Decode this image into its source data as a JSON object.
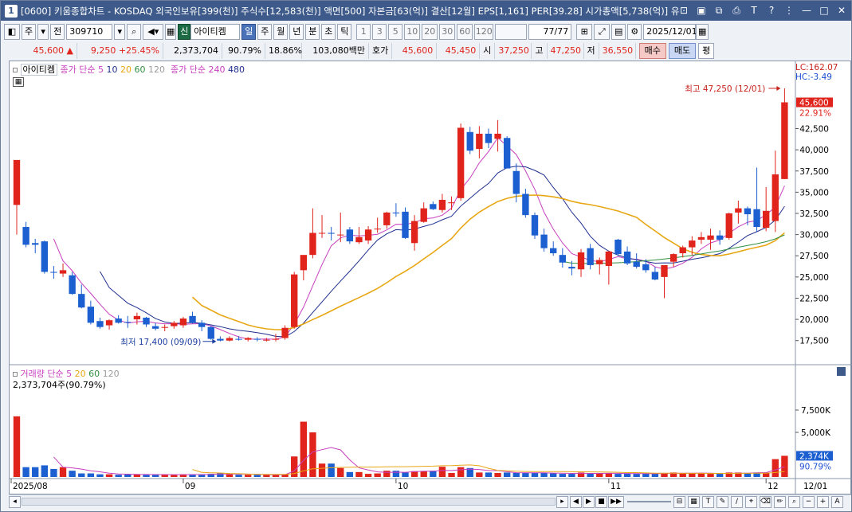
{
  "title": {
    "badge": "1",
    "text": "[0600] 키움종합차트 - KOSDAQ 외국인보유[399(천)] 주식수[12,583(천)] 액면[500] 자본금[63(억)] 결산[12월] EPS[1,161] PER[39.28] 시가총액[5,738(억)] 유"
  },
  "toolbar": {
    "mode_label": "주",
    "prev_label": "전",
    "code": "309710",
    "stock_badge": "신",
    "stock_name": "아이티켐",
    "period_buttons": [
      "일",
      "주",
      "월",
      "년",
      "분",
      "초",
      "틱"
    ],
    "interval_buttons": [
      "1",
      "3",
      "5",
      "10",
      "20",
      "30",
      "60",
      "120"
    ],
    "count": "77",
    "count_total": "/77",
    "date": "2025/12/01"
  },
  "quote": {
    "price": "45,600",
    "arrow": "▲",
    "change": "9,250",
    "change_pct": "+25.45%",
    "volume": "2,373,704",
    "vol_ratio": "90.79%",
    "turnover": "18.86%",
    "amount": "103,080백만",
    "hoga_label": "호가",
    "ask": "45,600",
    "bid": "45,450",
    "open_label": "시",
    "open": "37,250",
    "high_label": "고",
    "high": "47,250",
    "low_label": "저",
    "low": "36,550",
    "buy_label": "매수",
    "sell_label": "매도",
    "avg_label": "평"
  },
  "colors": {
    "up": "#e0241b",
    "down": "#1c5fd1",
    "ma5": "#c83fbf",
    "ma10": "#1f2f8f",
    "ma20": "#e8a714",
    "ma60": "#2f8f3f",
    "ma120": "#9a9a9a"
  },
  "price_panel": {
    "legend_name": "아이티켐",
    "legend_ma_prefix": "종가 단순",
    "legend_ma": [
      "5",
      "10",
      "20",
      "60",
      "120"
    ],
    "legend_ma2_prefix": "종가 단순",
    "legend_ma2": [
      "240",
      "480"
    ],
    "lc_label": "LC:162.07",
    "hc_label": "HC:-3.49",
    "current_tag": "45,600",
    "current_pct": "22.91%",
    "high_annotation": "최고 47,250 (12/01)",
    "low_annotation": "최저 17,400 (09/09)"
  },
  "volume_panel": {
    "legend_prefix": "거래량 단순",
    "legend_ma": [
      "5",
      "20",
      "60",
      "120"
    ],
    "value_label": "2,373,704주(90.79%)",
    "current_tag": "2,374K",
    "current_pct": "90.79%"
  },
  "x_axis": {
    "labels": [
      "2025/08",
      "09",
      "10",
      "11",
      "12",
      "12/01"
    ]
  },
  "chart_data": {
    "type": "candlestick",
    "y_ticks": [
      "42,500",
      "40,000",
      "37,500",
      "35,000",
      "32,500",
      "30,000",
      "27,500",
      "25,000",
      "22,500",
      "20,000",
      "17,500"
    ],
    "y_range": [
      15500,
      49500
    ],
    "vol_ticks": [
      "7,500K",
      "5,000K"
    ],
    "vol_range": [
      0,
      10000
    ],
    "candles": [
      [
        33500,
        38800,
        30000,
        38800,
        6800
      ],
      [
        30900,
        31500,
        28500,
        28800,
        1100
      ],
      [
        29000,
        29500,
        27800,
        28800,
        1100
      ],
      [
        29200,
        29300,
        25400,
        25600,
        1300
      ],
      [
        25600,
        26300,
        24800,
        25500,
        900
      ],
      [
        25400,
        26600,
        25000,
        25800,
        1100
      ],
      [
        25200,
        25600,
        22900,
        23000,
        700
      ],
      [
        23000,
        24100,
        21300,
        21400,
        400
      ],
      [
        21500,
        22200,
        19400,
        19600,
        400
      ],
      [
        19800,
        20200,
        18900,
        19100,
        300
      ],
      [
        19300,
        20000,
        18800,
        19900,
        300
      ],
      [
        20100,
        20500,
        19500,
        19600,
        250
      ],
      [
        19700,
        20400,
        19000,
        19600,
        300
      ],
      [
        20000,
        20800,
        19400,
        20400,
        300
      ],
      [
        20200,
        20300,
        19100,
        19400,
        250
      ],
      [
        19200,
        19600,
        18700,
        18900,
        250
      ],
      [
        19000,
        19400,
        18600,
        19100,
        250
      ],
      [
        19200,
        19800,
        18900,
        19600,
        250
      ],
      [
        19300,
        20300,
        19000,
        20100,
        300
      ],
      [
        20400,
        20900,
        19500,
        19600,
        300
      ],
      [
        19600,
        19900,
        18600,
        19100,
        250
      ],
      [
        19100,
        19200,
        17600,
        17700,
        350
      ],
      [
        17700,
        18000,
        17400,
        17500,
        450
      ],
      [
        17500,
        18000,
        17400,
        17800,
        300
      ],
      [
        17700,
        18000,
        17500,
        17600,
        250
      ],
      [
        17600,
        17900,
        17400,
        17800,
        250
      ],
      [
        17700,
        17900,
        17400,
        17600,
        250
      ],
      [
        17500,
        17800,
        17400,
        17600,
        250
      ],
      [
        17600,
        18300,
        17400,
        17700,
        250
      ],
      [
        17800,
        19300,
        17600,
        19000,
        300
      ],
      [
        19100,
        25600,
        18900,
        25300,
        2300
      ],
      [
        25800,
        27500,
        24600,
        27600,
        6200
      ],
      [
        27600,
        33100,
        27200,
        30200,
        5000
      ],
      [
        30200,
        32300,
        29600,
        30200,
        1500
      ],
      [
        30200,
        30900,
        29300,
        30100,
        1500
      ],
      [
        30000,
        32600,
        29100,
        30000,
        1000
      ],
      [
        30600,
        30900,
        28900,
        29200,
        550
      ],
      [
        29100,
        30900,
        28900,
        29700,
        550
      ],
      [
        29300,
        31000,
        28900,
        30600,
        350
      ],
      [
        30700,
        32000,
        30200,
        30700,
        400
      ],
      [
        31100,
        32700,
        30700,
        32600,
        700
      ],
      [
        32600,
        33700,
        32100,
        32500,
        700
      ],
      [
        32700,
        33200,
        29500,
        29600,
        500
      ],
      [
        29000,
        32300,
        28100,
        31600,
        650
      ],
      [
        31500,
        33800,
        31400,
        33100,
        650
      ],
      [
        33600,
        33900,
        32900,
        33000,
        700
      ],
      [
        32900,
        34800,
        32600,
        34100,
        1150
      ],
      [
        33700,
        34500,
        32900,
        33800,
        450
      ],
      [
        34300,
        43100,
        34000,
        42600,
        1100
      ],
      [
        42100,
        42700,
        39500,
        39900,
        1000
      ],
      [
        40100,
        42800,
        39000,
        41900,
        500
      ],
      [
        41900,
        42500,
        40200,
        40800,
        500
      ],
      [
        41300,
        43500,
        39800,
        41900,
        450
      ],
      [
        41400,
        41600,
        37800,
        37800,
        500
      ],
      [
        37500,
        38400,
        33800,
        34800,
        450
      ],
      [
        34800,
        35400,
        32000,
        32300,
        450
      ],
      [
        32300,
        32600,
        29500,
        29900,
        450
      ],
      [
        30000,
        30700,
        28000,
        28400,
        450
      ],
      [
        28400,
        29200,
        27500,
        27800,
        400
      ],
      [
        27600,
        28400,
        26100,
        26700,
        350
      ],
      [
        26200,
        26900,
        25200,
        26000,
        350
      ],
      [
        25900,
        28300,
        25000,
        27900,
        500
      ],
      [
        28400,
        28900,
        25900,
        26400,
        400
      ],
      [
        26500,
        27300,
        25300,
        27000,
        400
      ],
      [
        26300,
        28100,
        24100,
        28000,
        400
      ],
      [
        29400,
        29500,
        27500,
        27700,
        350
      ],
      [
        28000,
        28600,
        26400,
        26600,
        400
      ],
      [
        26800,
        27800,
        26000,
        26200,
        350
      ],
      [
        26500,
        27100,
        25500,
        25800,
        400
      ],
      [
        25600,
        26200,
        24600,
        24700,
        350
      ],
      [
        25000,
        26300,
        22500,
        26400,
        450
      ],
      [
        26800,
        27800,
        26200,
        27700,
        500
      ],
      [
        27800,
        28700,
        27300,
        28500,
        400
      ],
      [
        28500,
        29800,
        27600,
        29300,
        450
      ],
      [
        29400,
        30300,
        28900,
        29700,
        400
      ],
      [
        29400,
        30700,
        28200,
        29900,
        350
      ],
      [
        29900,
        30500,
        28800,
        29400,
        350
      ],
      [
        29600,
        32600,
        29400,
        32500,
        500
      ],
      [
        32600,
        34000,
        31300,
        33100,
        500
      ],
      [
        33100,
        33300,
        31100,
        32400,
        450
      ],
      [
        33000,
        37900,
        30300,
        30900,
        500
      ],
      [
        30800,
        35600,
        30400,
        32800,
        500
      ],
      [
        31600,
        39900,
        30300,
        37100,
        2000
      ],
      [
        36550,
        47250,
        36550,
        45600,
        2374
      ]
    ]
  },
  "status_bar": {
    "buttons": [
      "◀",
      "▶",
      "■",
      "▶▶"
    ],
    "right_icons": [
      "ruler-icon",
      "grid-icon",
      "text-icon",
      "zoom-icon",
      "minus-icon",
      "plus-icon",
      "font-icon"
    ]
  }
}
